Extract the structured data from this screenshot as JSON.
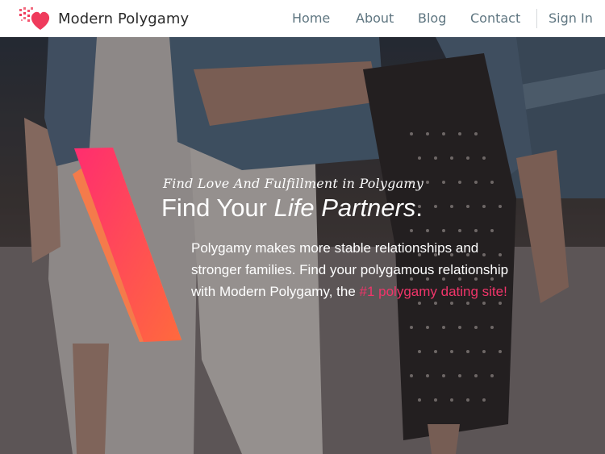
{
  "brand": {
    "name": "Modern Polygamy",
    "icon": "pixel-heart-icon",
    "color": "#ef3b5c"
  },
  "nav": {
    "items": [
      {
        "label": "Home"
      },
      {
        "label": "About"
      },
      {
        "label": "Blog"
      },
      {
        "label": "Contact"
      }
    ],
    "sign_in": "Sign In"
  },
  "hero": {
    "tagline": "Find Love And Fulfillment in Polygamy",
    "headline_start": "Find Your ",
    "headline_italic": "Life Partners",
    "headline_end": ".",
    "description_lines": [
      "Polygamy makes more stable relationships and",
      "stronger families. Find your polygamous relationship",
      "with Modern Polygamy, the "
    ],
    "description_highlight": "#1 polygamy dating site!",
    "accent_colors": [
      "#ff2d6f",
      "#ff6a3d"
    ],
    "highlight_color": "#f0356a"
  }
}
